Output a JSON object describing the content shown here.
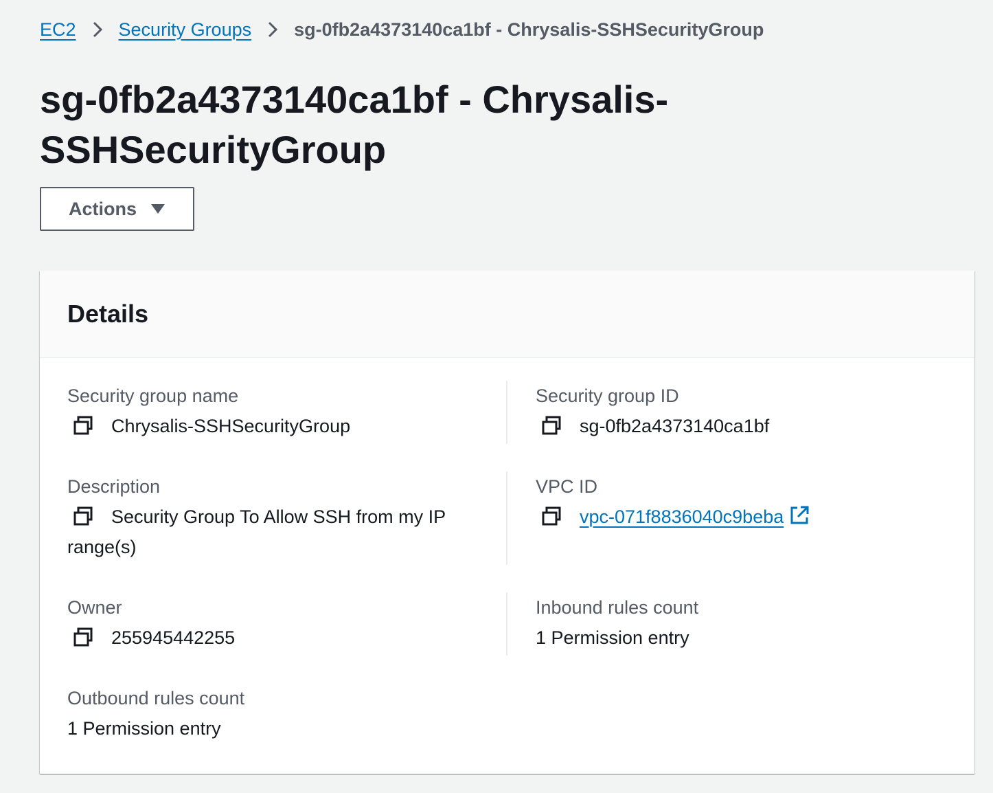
{
  "breadcrumb": {
    "root": "EC2",
    "section": "Security Groups",
    "current": "sg-0fb2a4373140ca1bf - Chrysalis-SSHSecurityGroup"
  },
  "page": {
    "title_line1": "sg-0fb2a4373140ca1bf - Chrysalis-",
    "title_line2": "SSHSecurityGroup"
  },
  "actions": {
    "label": "Actions"
  },
  "details": {
    "title": "Details",
    "sg_name_label": "Security group name",
    "sg_name_value": "Chrysalis-SSHSecurityGroup",
    "sg_id_label": "Security group ID",
    "sg_id_value": "sg-0fb2a4373140ca1bf",
    "description_label": "Description",
    "description_value": "Security Group To Allow SSH from my IP range(s)",
    "vpc_label": "VPC ID",
    "vpc_value": "vpc-071f8836040c9beba",
    "owner_label": "Owner",
    "owner_value": "255945442255",
    "inbound_label": "Inbound rules count",
    "inbound_value": "1 Permission entry",
    "outbound_label": "Outbound rules count",
    "outbound_value": "1 Permission entry"
  },
  "colors": {
    "link": "#0073bb",
    "text": "#16191f",
    "secondary_text": "#545b64",
    "background": "#f2f3f3"
  },
  "icons": [
    "chevron-right-icon",
    "caret-down-icon",
    "copy-icon",
    "external-link-icon"
  ]
}
